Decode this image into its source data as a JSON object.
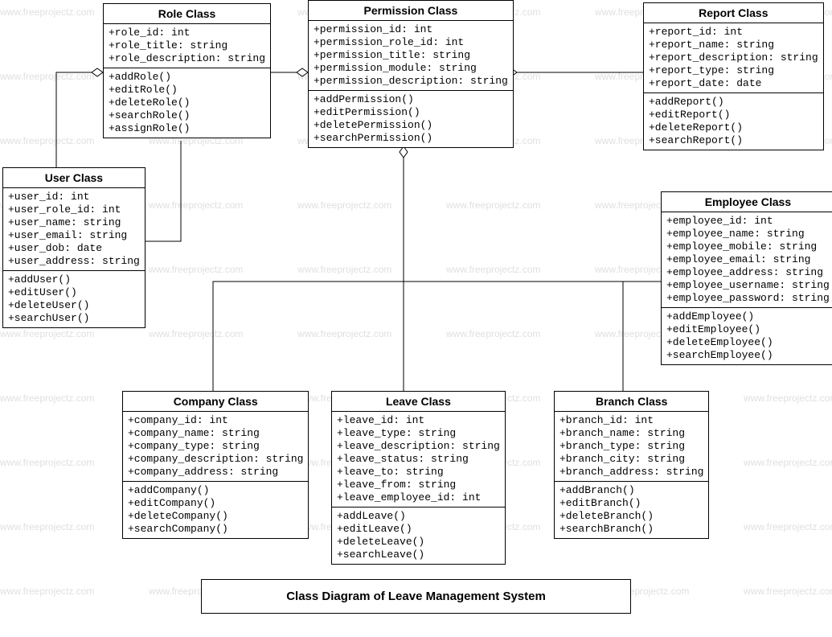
{
  "title": "Class Diagram of Leave Management System",
  "watermark_text": "www.freeprojectz.com",
  "classes": {
    "role": {
      "name": "Role Class",
      "attrs": [
        "+role_id: int",
        "+role_title: string",
        "+role_description: string"
      ],
      "ops": [
        "+addRole()",
        "+editRole()",
        "+deleteRole()",
        "+searchRole()",
        "+assignRole()"
      ]
    },
    "permission": {
      "name": "Permission Class",
      "attrs": [
        "+permission_id: int",
        "+permission_role_id: int",
        "+permission_title: string",
        "+permission_module: string",
        "+permission_description: string"
      ],
      "ops": [
        "+addPermission()",
        "+editPermission()",
        "+deletePermission()",
        "+searchPermission()"
      ]
    },
    "report": {
      "name": "Report Class",
      "attrs": [
        "+report_id: int",
        "+report_name: string",
        "+report_description: string",
        "+report_type: string",
        "+report_date: date"
      ],
      "ops": [
        "+addReport()",
        "+editReport()",
        "+deleteReport()",
        "+searchReport()"
      ]
    },
    "user": {
      "name": "User Class",
      "attrs": [
        "+user_id: int",
        "+user_role_id: int",
        "+user_name: string",
        "+user_email: string",
        "+user_dob: date",
        "+user_address: string"
      ],
      "ops": [
        "+addUser()",
        "+editUser()",
        "+deleteUser()",
        "+searchUser()"
      ]
    },
    "employee": {
      "name": "Employee Class",
      "attrs": [
        "+employee_id: int",
        "+employee_name: string",
        "+employee_mobile: string",
        "+employee_email: string",
        "+employee_address: string",
        "+employee_username: string",
        "+employee_password: string"
      ],
      "ops": [
        "+addEmployee()",
        "+editEmployee()",
        "+deleteEmployee()",
        "+searchEmployee()"
      ]
    },
    "company": {
      "name": "Company Class",
      "attrs": [
        "+company_id: int",
        "+company_name: string",
        "+company_type: string",
        "+company_description: string",
        "+company_address: string"
      ],
      "ops": [
        "+addCompany()",
        "+editCompany()",
        "+deleteCompany()",
        "+searchCompany()"
      ]
    },
    "leave": {
      "name": "Leave Class",
      "attrs": [
        "+leave_id: int",
        "+leave_type: string",
        "+leave_description: string",
        "+leave_status: string",
        "+leave_to: string",
        "+leave_from: string",
        "+leave_employee_id: int"
      ],
      "ops": [
        "+addLeave()",
        "+editLeave()",
        "+deleteLeave()",
        "+searchLeave()"
      ]
    },
    "branch": {
      "name": "Branch Class",
      "attrs": [
        "+branch_id: int",
        "+branch_name: string",
        "+branch_type: string",
        "+branch_city: string",
        "+branch_address: string"
      ],
      "ops": [
        "+addBranch()",
        "+editBranch()",
        "+deleteBranch()",
        "+searchBranch()"
      ]
    }
  }
}
